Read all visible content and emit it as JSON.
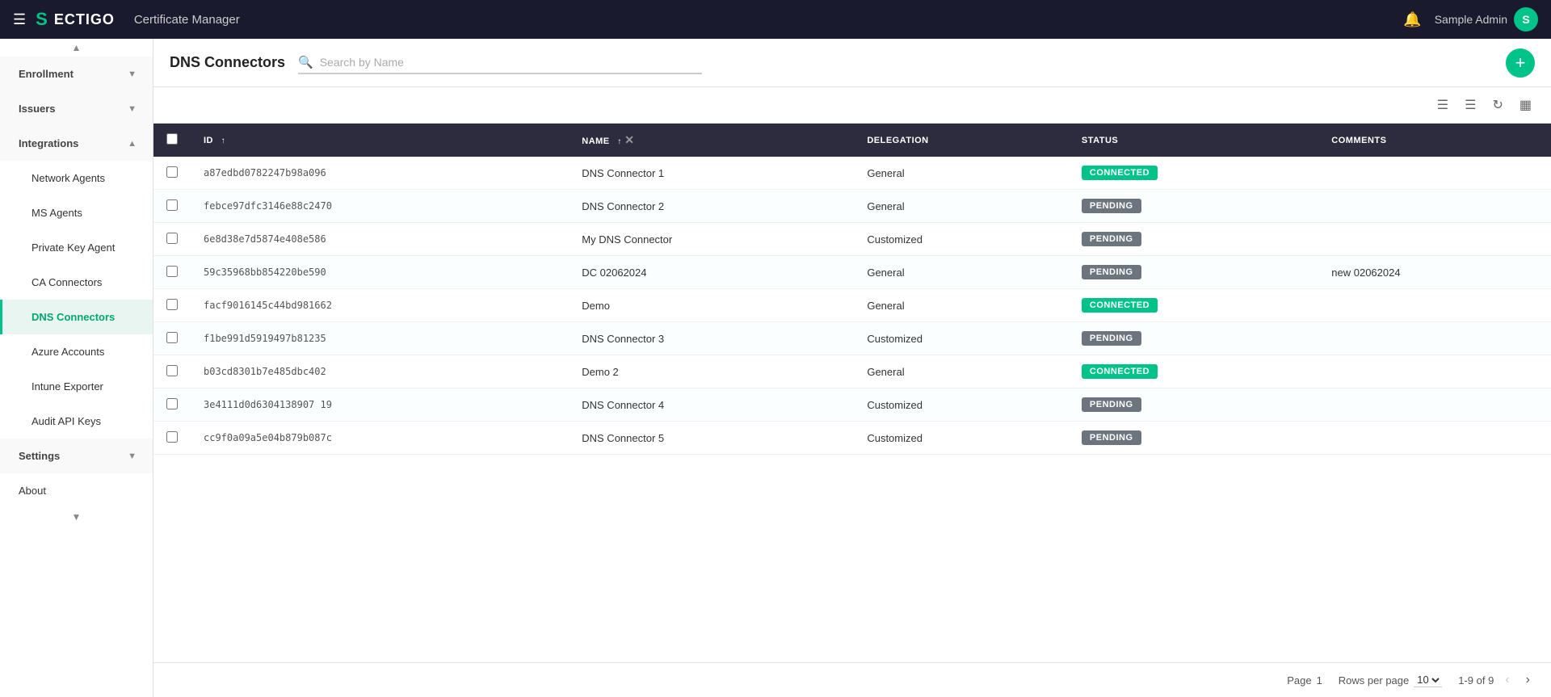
{
  "topbar": {
    "hamburger_label": "☰",
    "logo_symbol": "S",
    "logo_text": "ECTIGO",
    "app_title": "Certificate Manager",
    "bell_icon": "🔔",
    "user_name": "Sample Admin",
    "avatar_letter": "S"
  },
  "sidebar": {
    "scroll_up": "▲",
    "scroll_down": "▼",
    "items": [
      {
        "id": "enrollment",
        "label": "Enrollment",
        "chevron": "▼",
        "type": "section"
      },
      {
        "id": "issuers",
        "label": "Issuers",
        "chevron": "▼",
        "type": "section"
      },
      {
        "id": "integrations",
        "label": "Integrations",
        "chevron": "▲",
        "type": "section"
      },
      {
        "id": "network-agents",
        "label": "Network Agents",
        "type": "sub"
      },
      {
        "id": "ms-agents",
        "label": "MS Agents",
        "type": "sub"
      },
      {
        "id": "private-key-agent",
        "label": "Private Key Agent",
        "type": "sub"
      },
      {
        "id": "ca-connectors",
        "label": "CA Connectors",
        "type": "sub"
      },
      {
        "id": "dns-connectors",
        "label": "DNS Connectors",
        "type": "sub",
        "active": true
      },
      {
        "id": "azure-accounts",
        "label": "Azure Accounts",
        "type": "sub"
      },
      {
        "id": "intune-exporter",
        "label": "Intune Exporter",
        "type": "sub"
      },
      {
        "id": "audit-api-keys",
        "label": "Audit API Keys",
        "type": "sub"
      },
      {
        "id": "settings",
        "label": "Settings",
        "chevron": "▼",
        "type": "section"
      },
      {
        "id": "about",
        "label": "About",
        "type": "item"
      }
    ]
  },
  "page": {
    "title": "DNS Connectors",
    "search_placeholder": "Search by Name",
    "add_button_label": "+",
    "toolbar": {
      "filter_icon": "≡",
      "columns_icon": "⋮⋮",
      "refresh_icon": "↺",
      "chart_icon": "▦"
    }
  },
  "table": {
    "columns": [
      {
        "id": "checkbox",
        "label": ""
      },
      {
        "id": "id",
        "label": "ID",
        "sortable": true
      },
      {
        "id": "name",
        "label": "NAME",
        "sortable": true
      },
      {
        "id": "delegation",
        "label": "DELEGATION"
      },
      {
        "id": "status",
        "label": "STATUS"
      },
      {
        "id": "comments",
        "label": "COMMENTS"
      }
    ],
    "rows": [
      {
        "id": "a87edbd0782247b98a096",
        "name": "DNS Connector 1",
        "delegation": "General",
        "status": "CONNECTED",
        "comments": ""
      },
      {
        "id": "febce97dfc3146e88c2470",
        "name": "DNS Connector 2",
        "delegation": "General",
        "status": "PENDING",
        "comments": ""
      },
      {
        "id": "6e8d38e7d5874e408e586",
        "name": "My DNS Connector",
        "delegation": "Customized",
        "status": "PENDING",
        "comments": ""
      },
      {
        "id": "59c35968bb854220be590",
        "name": "DC 02062024",
        "delegation": "General",
        "status": "PENDING",
        "comments": "new 02062024"
      },
      {
        "id": "facf9016145c44bd981662",
        "name": "Demo",
        "delegation": "General",
        "status": "CONNECTED",
        "comments": ""
      },
      {
        "id": "f1be991d5919497b81235",
        "name": "DNS Connector 3",
        "delegation": "Customized",
        "status": "PENDING",
        "comments": ""
      },
      {
        "id": "b03cd8301b7e485dbc402",
        "name": "Demo 2",
        "delegation": "General",
        "status": "CONNECTED",
        "comments": ""
      },
      {
        "id": "3e4111d0d6304138907 19",
        "name": "DNS Connector 4",
        "delegation": "Customized",
        "status": "PENDING",
        "comments": ""
      },
      {
        "id": "cc9f0a09a5e04b879b087c",
        "name": "DNS Connector 5",
        "delegation": "Customized",
        "status": "PENDING",
        "comments": ""
      }
    ]
  },
  "footer": {
    "page_label": "Page",
    "page_number": "1",
    "rows_per_page_label": "Rows per page",
    "rows_per_page_value": "10",
    "range_label": "1-9 of 9",
    "prev_icon": "‹",
    "next_icon": "›"
  }
}
